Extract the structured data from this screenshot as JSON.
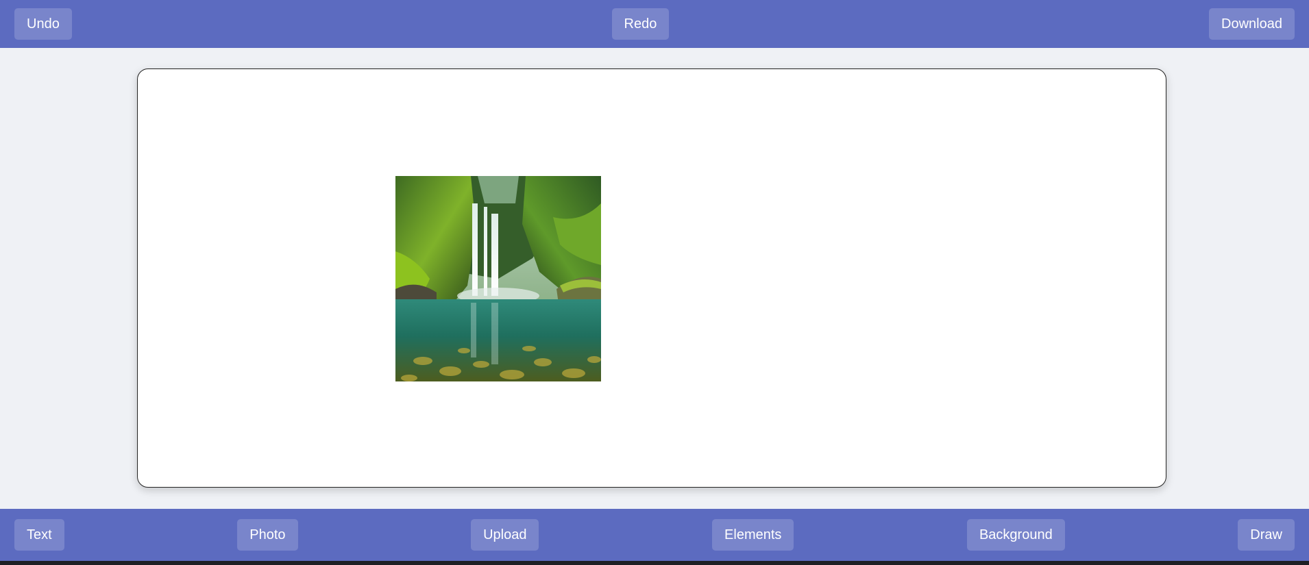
{
  "top_toolbar": {
    "undo_label": "Undo",
    "redo_label": "Redo",
    "download_label": "Download"
  },
  "bottom_toolbar": {
    "text_label": "Text",
    "photo_label": "Photo",
    "upload_label": "Upload",
    "elements_label": "Elements",
    "background_label": "Background",
    "draw_label": "Draw"
  },
  "colors": {
    "toolbar_bg": "#5c6bc0",
    "page_bg": "#eff1f5",
    "canvas_bg": "#ffffff"
  },
  "canvas": {
    "image_subject": "waterfall-landscape-photo"
  }
}
